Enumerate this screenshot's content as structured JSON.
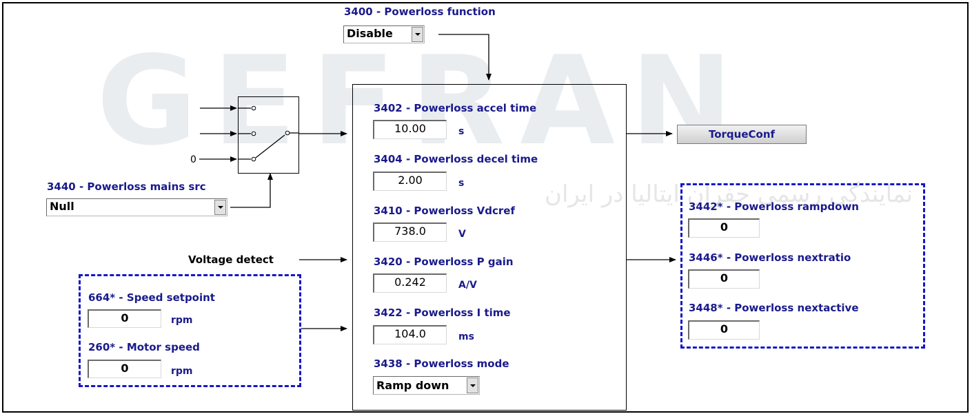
{
  "watermark": {
    "brand": "GEFRAN",
    "subtitle": "نمایندگی رسمی جفران ایتالیا در ایران"
  },
  "function_block": {
    "label": "3400 - Powerloss function",
    "value": "Disable"
  },
  "mains_src": {
    "label": "3440 - Powerloss mains src",
    "value": "Null",
    "switch_input_zero": "0"
  },
  "voltage_detect": {
    "label": "Voltage detect"
  },
  "speed_group": {
    "speed_setpoint": {
      "label": "664* - Speed setpoint",
      "value": "0",
      "unit": "rpm"
    },
    "motor_speed": {
      "label": "260* - Motor speed",
      "value": "0",
      "unit": "rpm"
    }
  },
  "params": {
    "accel_time": {
      "label": "3402 - Powerloss accel time",
      "value": "10.00",
      "unit": "s"
    },
    "decel_time": {
      "label": "3404 - Powerloss decel time",
      "value": "2.00",
      "unit": "s"
    },
    "vdcref": {
      "label": "3410 - Powerloss Vdcref",
      "value": "738.0",
      "unit": "V"
    },
    "p_gain": {
      "label": "3420 - Powerloss P gain",
      "value": "0.242",
      "unit": "A/V"
    },
    "i_time": {
      "label": "3422 - Powerloss I time",
      "value": "104.0",
      "unit": "ms"
    },
    "mode": {
      "label": "3438 - Powerloss mode",
      "value": "Ramp down"
    }
  },
  "torque_button": {
    "label": "TorqueConf"
  },
  "outputs": {
    "rampdown": {
      "label": "3442* - Powerloss rampdown",
      "value": "0"
    },
    "nextratio": {
      "label": "3446* - Powerloss nextratio",
      "value": "0"
    },
    "nextactive": {
      "label": "3448* - Powerloss nextactive",
      "value": "0"
    }
  }
}
